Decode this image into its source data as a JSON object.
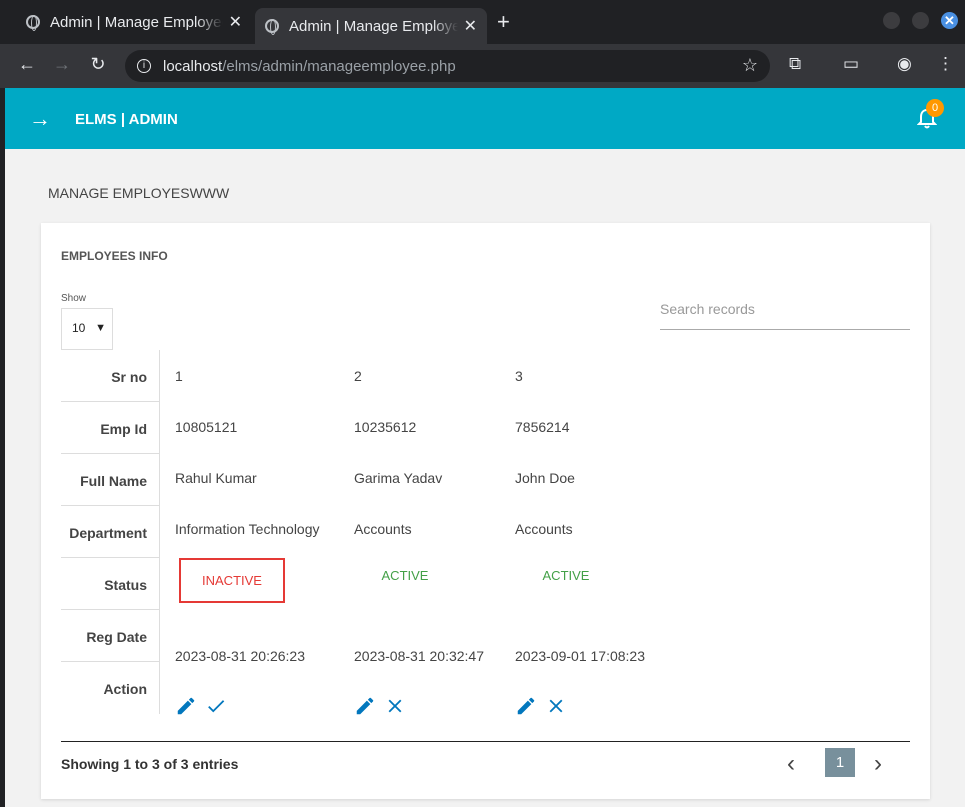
{
  "browser": {
    "tabs": [
      {
        "title": "Admin | Manage Employee"
      },
      {
        "title": "Admin | Manage Employee"
      }
    ],
    "url_host": "localhost",
    "url_path": "/elms/admin/manageemployee.php"
  },
  "header": {
    "brand": "ELMS | ADMIN",
    "notification_count": "0"
  },
  "page": {
    "title": "MANAGE EMPLOYESWWW"
  },
  "card": {
    "title": "EMPLOYEES INFO",
    "show_label": "Show",
    "show_value": "10",
    "search_placeholder": "Search records"
  },
  "table": {
    "columns": [
      "Sr no",
      "Emp Id",
      "Full Name",
      "Department",
      "Status",
      "Reg Date",
      "Action"
    ],
    "rows": [
      {
        "sr": "1",
        "emp_id": "10805121",
        "name": "Rahul Kumar",
        "department": "Information Technology",
        "status": "INACTIVE",
        "reg_date": "2023-08-31 20:26:23",
        "toggle_icon": "check-icon"
      },
      {
        "sr": "2",
        "emp_id": "10235612",
        "name": "Garima Yadav",
        "department": "Accounts",
        "status": "ACTIVE",
        "reg_date": "2023-08-31 20:32:47",
        "toggle_icon": "close-icon"
      },
      {
        "sr": "3",
        "emp_id": "7856214",
        "name": "John Doe",
        "department": "Accounts",
        "status": "ACTIVE",
        "reg_date": "2023-09-01 17:08:23",
        "toggle_icon": "close-icon"
      }
    ]
  },
  "footer": {
    "info": "Showing 1 to 3 of 3 entries",
    "current_page": "1"
  },
  "colors": {
    "appbar": "#00a9c5",
    "badge": "#ff9800",
    "inactive": "#e53935",
    "active": "#43a047",
    "action_icon": "#0277bd"
  }
}
